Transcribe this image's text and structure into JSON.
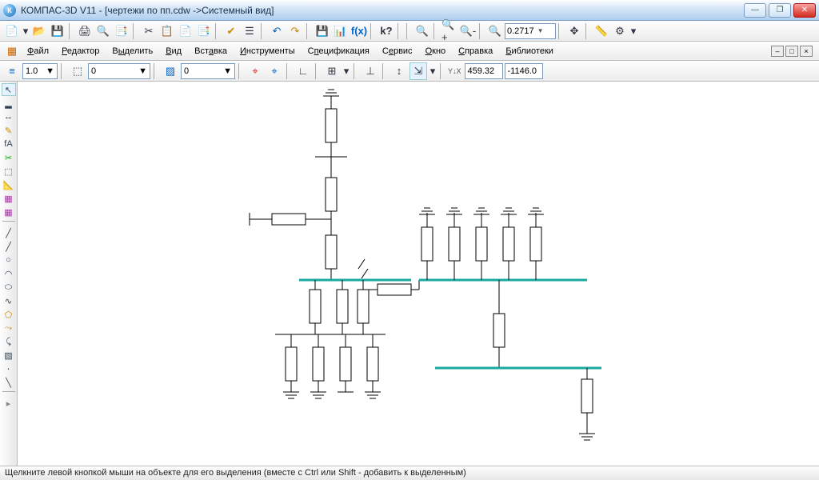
{
  "title": "КОМПАС-3D V11 - [чертежи по пп.cdw ->Системный вид]",
  "zoom": "0.2717",
  "menu": {
    "file": "Файл",
    "editor": "Редактор",
    "select": "Выделить",
    "view": "Вид",
    "insert": "Вставка",
    "tools": "Инструменты",
    "spec": "Спецификация",
    "service": "Сервис",
    "window": "Окно",
    "help": "Справка",
    "libs": "Библиотеки"
  },
  "row3": {
    "val1": "1.0",
    "val2": "0",
    "val3": "0",
    "coordX": "459.32",
    "coordY": "-1146.0"
  },
  "status": "Щелкните левой кнопкой мыши на объекте для его выделения (вместе с Ctrl или Shift - добавить к выделенным)",
  "winbtn": {
    "min": "—",
    "max": "❐",
    "close": "✕"
  },
  "mdi": {
    "min": "–",
    "max": "□",
    "close": "×"
  }
}
